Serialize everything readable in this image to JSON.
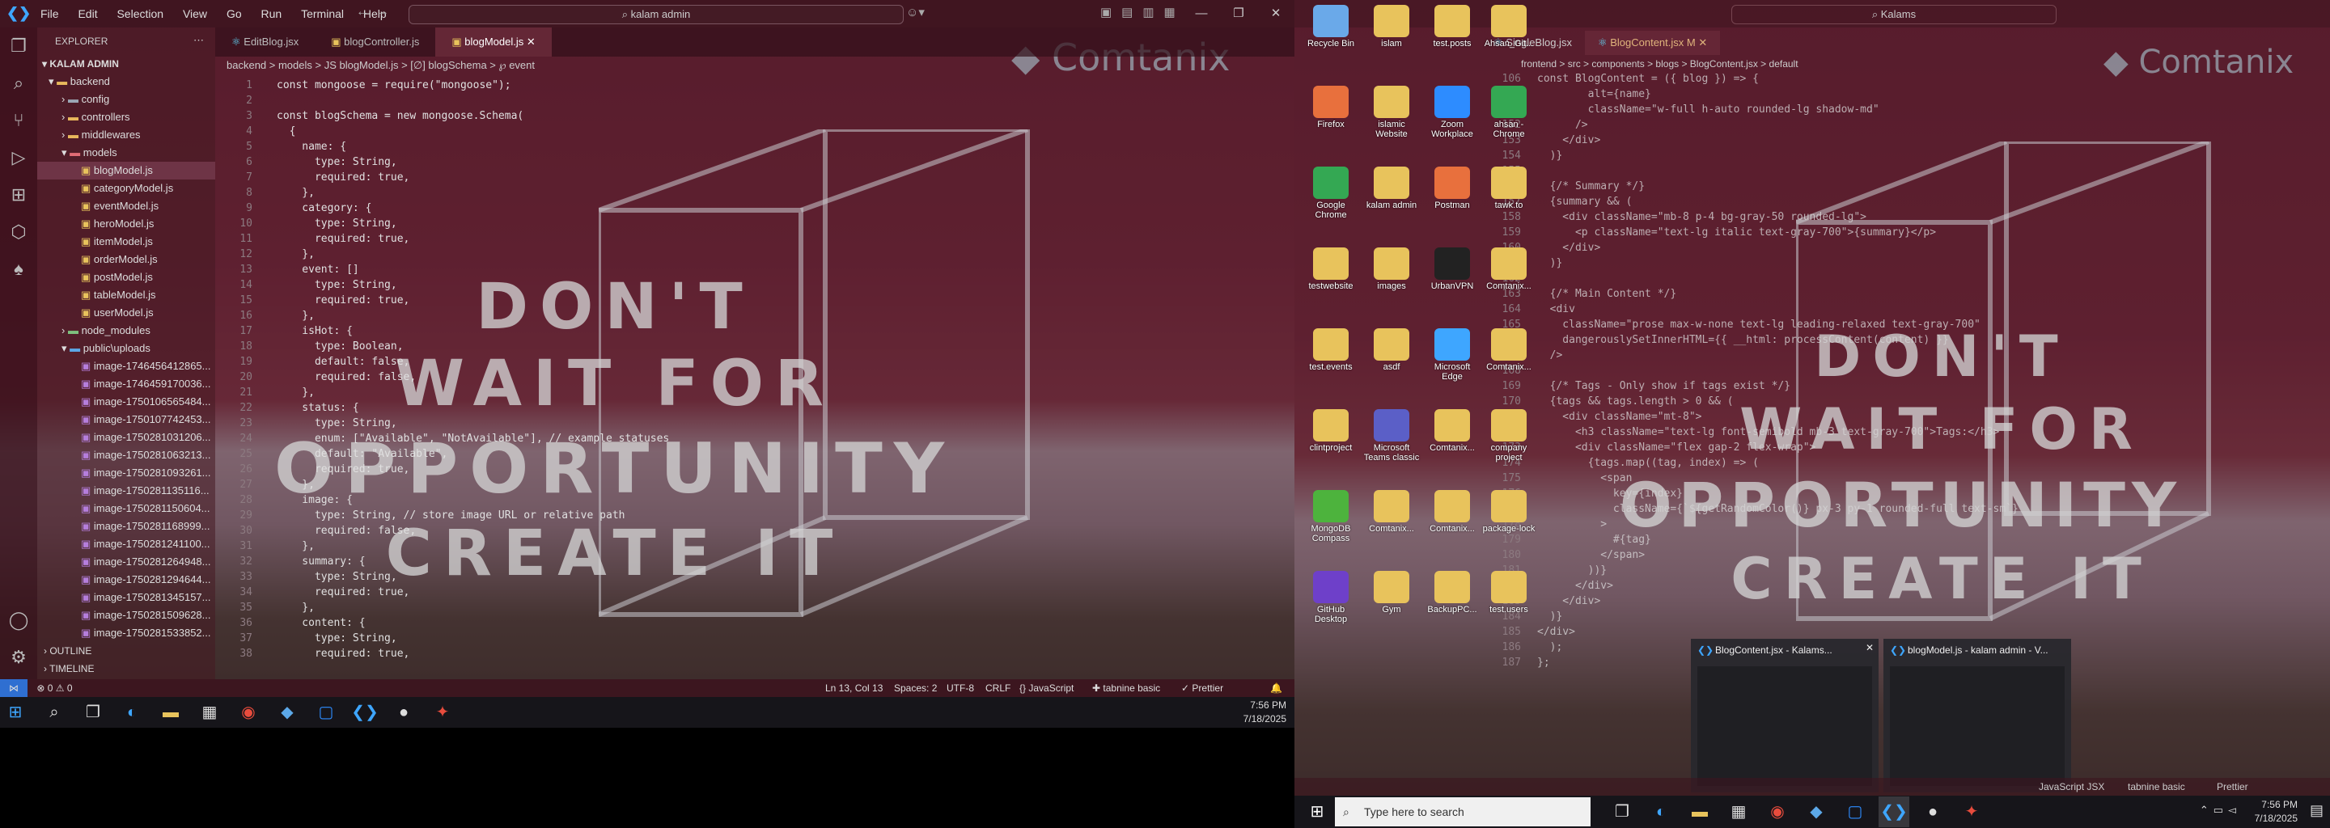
{
  "left": {
    "titlebar": {
      "menu": [
        "File",
        "Edit",
        "Selection",
        "View",
        "Go",
        "Run",
        "Terminal",
        "Help"
      ],
      "search": "kalam admin"
    },
    "explorer": {
      "title": "EXPLORER",
      "root": "KALAM ADMIN",
      "tree": [
        "backend",
        "config",
        "controllers",
        "middlewares",
        "models",
        "blogModel.js",
        "categoryModel.js",
        "eventModel.js",
        "heroModel.js",
        "itemModel.js",
        "orderModel.js",
        "postModel.js",
        "tableModel.js",
        "userModel.js",
        "node_modules",
        "public\\uploads",
        "image-1746456412865...",
        "image-1746459170036...",
        "image-1750106565484...",
        "image-1750107742453...",
        "image-1750281031206...",
        "image-1750281063213...",
        "image-1750281093261...",
        "image-1750281135116...",
        "image-1750281150604...",
        "image-1750281168999...",
        "image-1750281241100...",
        "image-1750281264948...",
        "image-1750281294644...",
        "image-1750281345157...",
        "image-1750281509628...",
        "image-1750281533852..."
      ],
      "outline": "OUTLINE",
      "timeline": "TIMELINE"
    },
    "tabs": [
      "EditBlog.jsx",
      "blogController.js",
      "blogModel.js"
    ],
    "breadcrumb": "backend > models > JS blogModel.js > [∅] blogSchema > ℘ event",
    "code": [
      "const mongoose = require(\"mongoose\");",
      "",
      "const blogSchema = new mongoose.Schema(",
      "  {",
      "    name: {",
      "      type: String,",
      "      required: true,",
      "    },",
      "    category: {",
      "      type: String,",
      "      required: true,",
      "    },",
      "    event: []",
      "      type: String,",
      "      required: true,",
      "    },",
      "    isHot: {",
      "      type: Boolean,",
      "      default: false,",
      "      required: false,",
      "    },",
      "    status: {",
      "      type: String,",
      "      enum: [\"Available\", \"NotAvailable\"], // example statuses",
      "      default: \"Available\",",
      "      required: true,",
      "    },",
      "    image: {",
      "      type: String, // store image URL or relative path",
      "      required: false,",
      "    },",
      "    summary: {",
      "      type: String,",
      "      required: true,",
      "    },",
      "    content: {",
      "      type: String,",
      "      required: true,"
    ],
    "status": {
      "errors": "⊗ 0 ⚠ 0",
      "position": "Ln 13, Col 13",
      "spaces": "Spaces: 2",
      "encoding": "UTF-8",
      "eol": "CRLF",
      "lang": "{} JavaScript",
      "tabnine": "tabnine basic",
      "prettier": "✓ Prettier"
    },
    "clock": {
      "time": "7:56 PM",
      "date": "7/18/2025"
    }
  },
  "wallpaper": {
    "logo": "Comtanix",
    "quote": [
      "DON'T",
      "WAIT FOR",
      "OPPORTUNITY",
      "CREATE IT"
    ]
  },
  "right": {
    "search": "Kalams",
    "tabs": [
      "SingleBlog.jsx",
      "BlogContent.jsx M"
    ],
    "breadcrumb": "frontend > src > components > blogs > BlogContent.jsx > default",
    "code": [
      "const BlogContent = ({ blog }) => {",
      "        alt={name}",
      "        className=\"w-full h-auto rounded-lg shadow-md\"",
      "      />",
      "    </div>",
      "  )}",
      "",
      "  {/* Summary */}",
      "  {summary && (",
      "    <div className=\"mb-8 p-4 bg-gray-50 rounded-lg\">",
      "      <p className=\"text-lg italic text-gray-700\">{summary}</p>",
      "    </div>",
      "  )}",
      "",
      "  {/* Main Content */}",
      "  <div",
      "    className=\"prose max-w-none text-lg leading-relaxed text-gray-700\"",
      "    dangerouslySetInnerHTML={{ __html: processContent(content) }}",
      "  />",
      "",
      "  {/* Tags - Only show if tags exist */}",
      "  {tags && tags.length > 0 && (",
      "    <div className=\"mt-8\">",
      "      <h3 className=\"text-lg font-semibold mb-3 text-gray-700\">Tags:</h3>",
      "      <div className=\"flex gap-2 flex-wrap\">",
      "        {tags.map((tag, index) => (",
      "          <span",
      "            key={index}",
      "            className={`${getRandomColor()} px-3 py-1 rounded-full text-sm`}",
      "          >",
      "            #{tag}",
      "          </span>",
      "        ))}",
      "      </div>",
      "    </div>",
      "  )}",
      "</div>",
      "  );",
      "};"
    ],
    "desktop_icons": [
      "Recycle Bin",
      "islam",
      "test.posts",
      "Ahsan_Git...",
      "Firefox",
      "islamic Website",
      "Zoom Workplace",
      "ahsan - Chrome",
      "Google Chrome",
      "kalam admin",
      "Postman",
      "tawk.to",
      "testwebsite",
      "images",
      "UrbanVPN",
      "Comtanix...",
      "test.events",
      "asdf",
      "Microsoft Edge",
      "Comtanix...",
      "clintproject",
      "Microsoft Teams classic",
      "Comtanix...",
      "company project",
      "MongoDB Compass",
      "Comtanix...",
      "Comtanix...",
      "package-lock",
      "GitHub Desktop",
      "Gym",
      "BackupPC...",
      "test.users"
    ],
    "thumbs": [
      "BlogContent.jsx - Kalams...",
      "blogModel.js - kalam admin - V..."
    ],
    "status": {
      "lang": "JavaScript JSX",
      "tabnine": "tabnine basic",
      "prettier": "Prettier"
    },
    "taskbar": {
      "search": "Type here to search"
    },
    "clock": {
      "time": "7:56 PM",
      "date": "7/18/2025"
    }
  }
}
